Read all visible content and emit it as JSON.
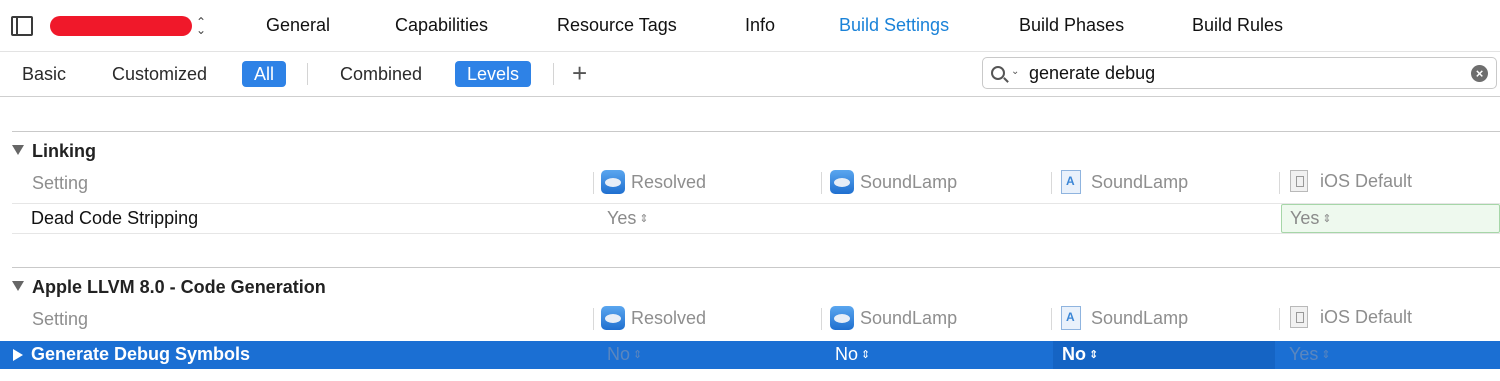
{
  "tabs": [
    "General",
    "Capabilities",
    "Resource Tags",
    "Info",
    "Build Settings",
    "Build Phases",
    "Build Rules"
  ],
  "active_tab": "Build Settings",
  "target_chevrons": "⌃⌄",
  "filters": {
    "basic": "Basic",
    "customized": "Customized",
    "all": "All",
    "combined": "Combined",
    "levels": "Levels",
    "add": "+"
  },
  "search": {
    "value": "generate debug",
    "caret": "⌄",
    "clear": "×"
  },
  "sections": [
    {
      "title": "Linking",
      "columns": {
        "setting": "Setting",
        "resolved": "Resolved",
        "project": "SoundLamp",
        "target": "SoundLamp",
        "default": "iOS Default"
      },
      "rows": [
        {
          "name": "Dead Code Stripping",
          "resolved": "Yes",
          "project": "",
          "target": "",
          "default": "Yes"
        }
      ]
    },
    {
      "title": "Apple LLVM 8.0 - Code Generation",
      "columns": {
        "setting": "Setting",
        "resolved": "Resolved",
        "project": "SoundLamp",
        "target": "SoundLamp",
        "default": "iOS Default"
      },
      "rows": [
        {
          "name": "Generate Debug Symbols",
          "resolved": "No",
          "project": "No",
          "target": "No",
          "default": "Yes"
        }
      ]
    }
  ],
  "colors": {
    "accent": "#1a82d8",
    "selection": "#1b6fd3",
    "filter_selected": "#2e82e6",
    "default_cell_border": "#a6d6a8"
  }
}
